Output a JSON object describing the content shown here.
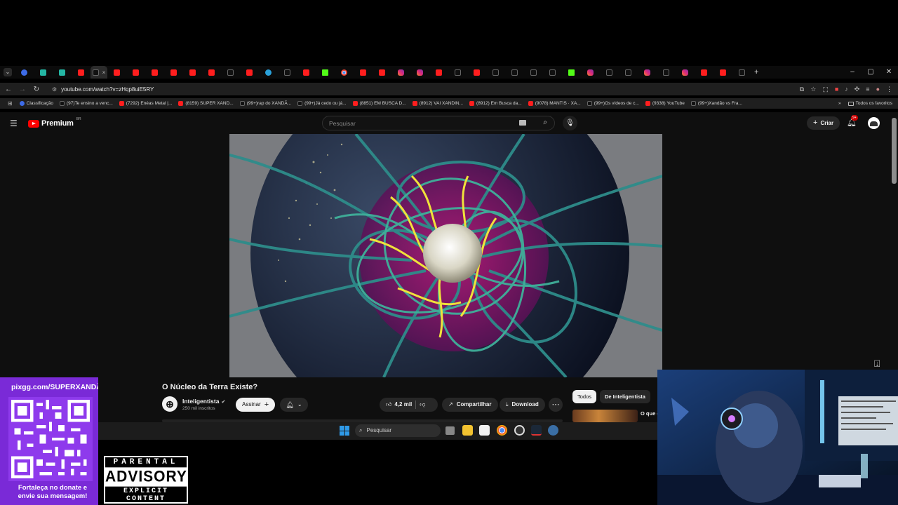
{
  "browser": {
    "url": "youtube.com/watch?v=zHqp8uiE5RY",
    "tab_count": 39,
    "active_tab_close": "×",
    "new_tab": "+",
    "bookmarks": [
      {
        "label": "Classificação",
        "icon": "gm"
      },
      {
        "label": "(97)Te ensino a venc...",
        "icon": "tt"
      },
      {
        "label": "(7292) Enéas Metal |...",
        "icon": "yt"
      },
      {
        "label": "(8159) SUPER XAND...",
        "icon": "yt"
      },
      {
        "label": "(99+)rap do XANDÃ...",
        "icon": "tt"
      },
      {
        "label": "(99+)Já cedo ou já...",
        "icon": "tt"
      },
      {
        "label": "(8851) EM BUSCA D...",
        "icon": "yt"
      },
      {
        "label": "(8912) VAI XANDIN...",
        "icon": "yt"
      },
      {
        "label": "(8912) Em Busca da...",
        "icon": "yt"
      },
      {
        "label": "(9078) MANTIS · XA...",
        "icon": "yt"
      },
      {
        "label": "(99+)Os vídeos de c...",
        "icon": "tt"
      },
      {
        "label": "(9338) YouTube",
        "icon": "yt"
      },
      {
        "label": "(99+)Xandão vs Fra...",
        "icon": "tt"
      }
    ],
    "all_favorites": "Todos os favoritos"
  },
  "youtube": {
    "logo_text": "Premium",
    "logo_region": "BR",
    "search_placeholder": "Pesquisar",
    "create_label": "Criar",
    "notifications_badge": "9+",
    "video_title": "O Núcleo da Terra Existe?",
    "channel_name": "Inteligentista",
    "subscribers": "250 mil inscritos",
    "subscribe_label": "Assinar",
    "likes": "4,2 mil",
    "share_label": "Compartilhar",
    "download_label": "Download",
    "chip_all": "Todos",
    "chip_channel": "De Inteligentista",
    "reco_title": "O que é"
  },
  "taskbar": {
    "search_placeholder": "Pesquisar"
  },
  "overlay": {
    "qr_header": "pixgg.com/SUPERXANDÃ",
    "qr_line1": "Fortaleça no donate e",
    "qr_line2": "envie sua mensagem!",
    "advisory_top": "PARENTAL",
    "advisory_mid": "ADVISORY",
    "advisory_bottom": "EXPLICIT CONTENT"
  }
}
